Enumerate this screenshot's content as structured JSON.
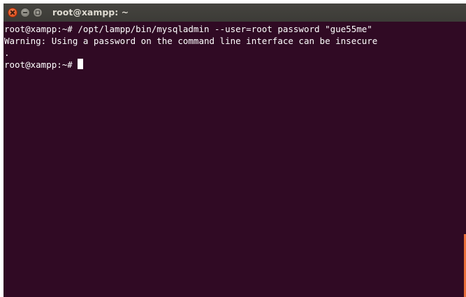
{
  "window": {
    "title": "root@xampp: ~",
    "close_icon": "close-icon",
    "minimize_icon": "minimize-icon",
    "maximize_icon": "maximize-icon"
  },
  "terminal": {
    "background": "#300a24",
    "text_color": "#ffffff",
    "lines": [
      "root@xampp:~# /opt/lampp/bin/mysqladmin --user=root password \"gue55me\"",
      "Warning: Using a password on the command line interface can be insecure",
      "."
    ],
    "prompt": "root@xampp:~# "
  }
}
